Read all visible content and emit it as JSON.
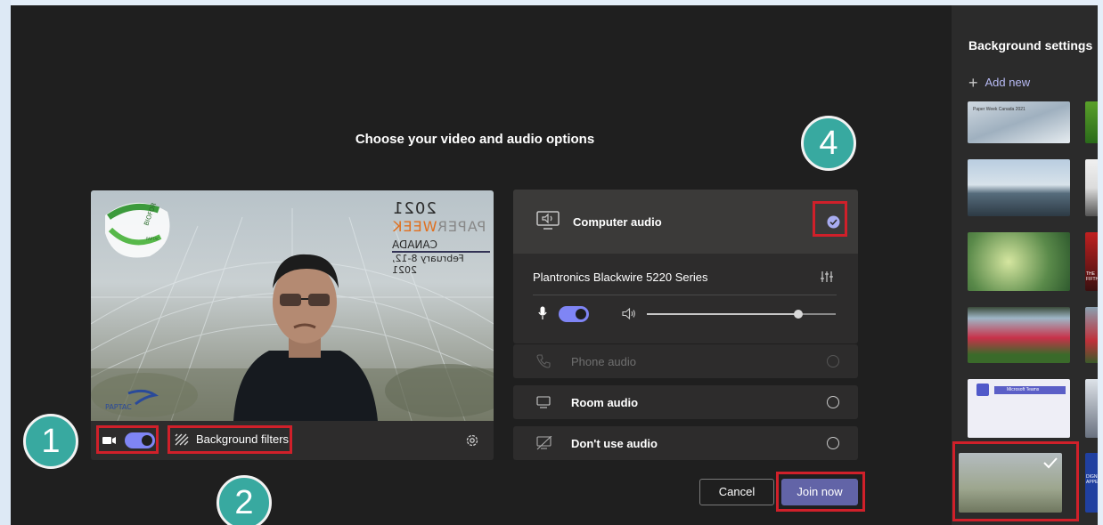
{
  "dialog": {
    "title": "Choose your video and audio options"
  },
  "video": {
    "background_filters_label": "Background filters",
    "overlay": {
      "year": "2021",
      "brand_left": "PAPER",
      "brand_right": "WEEK",
      "country": "CANADA",
      "dates": "February 8-12, 2021",
      "logo_top": "BIOFOR",
      "logo_sub": "PAPTAC",
      "logo_bottom": "PAPTAC"
    },
    "camera_on": true
  },
  "audio": {
    "computer_label": "Computer audio",
    "device_name": "Plantronics Blackwire 5220 Series",
    "mic_on": true,
    "volume": 0.8,
    "options": [
      {
        "label": "Phone audio",
        "enabled": false,
        "icon": "phone-icon"
      },
      {
        "label": "Room audio",
        "enabled": true,
        "icon": "monitor-icon"
      },
      {
        "label": "Don't use audio",
        "enabled": true,
        "icon": "speaker-off-icon"
      }
    ]
  },
  "buttons": {
    "cancel": "Cancel",
    "join": "Join now"
  },
  "side_panel": {
    "title": "Background settings",
    "add_new": "Add new",
    "thumb_labels": {
      "winter": "Paper Week Canada 2021",
      "teams": "Microsoft Teams",
      "right_edge_3": "THE FIFTH",
      "right_edge_6": "DIGNE APPEL"
    }
  },
  "annotations": [
    "1",
    "2",
    "4"
  ],
  "colors": {
    "accent": "#6264a7",
    "toggle": "#7f85f5",
    "highlight": "#d0202a",
    "badge": "#38a9a0"
  }
}
